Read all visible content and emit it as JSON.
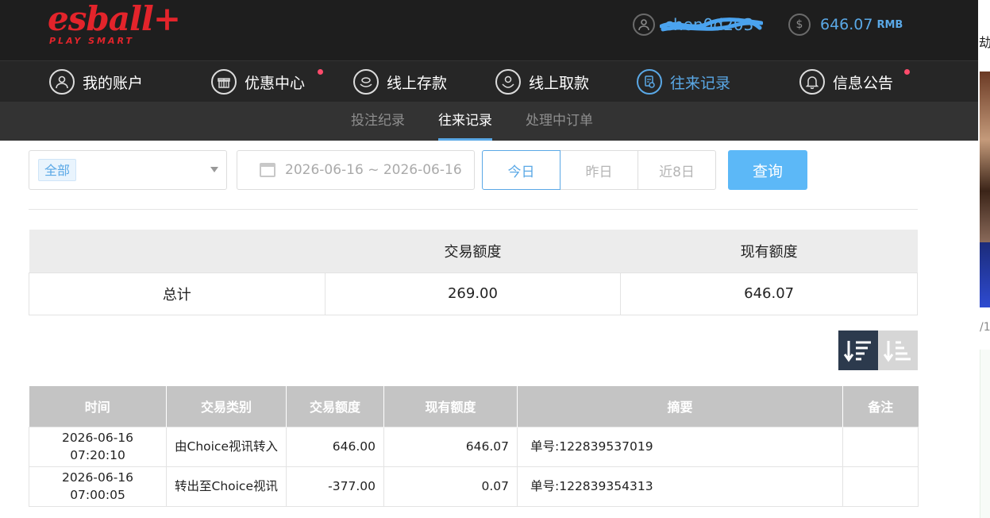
{
  "header": {
    "logo_text": "esball+",
    "logo_sub": "PLAY SMART",
    "username": "chen0d203",
    "balance": "646.07",
    "currency": "RMB"
  },
  "main_nav": [
    {
      "label": "我的账户",
      "icon": "user-icon",
      "active": false,
      "dot": false
    },
    {
      "label": "优惠中心",
      "icon": "gift-icon",
      "active": false,
      "dot": true
    },
    {
      "label": "线上存款",
      "icon": "deposit-icon",
      "active": false,
      "dot": false
    },
    {
      "label": "线上取款",
      "icon": "withdraw-icon",
      "active": false,
      "dot": false
    },
    {
      "label": "往来记录",
      "icon": "record-icon",
      "active": true,
      "dot": false
    },
    {
      "label": "信息公告",
      "icon": "bell-icon",
      "active": false,
      "dot": true
    }
  ],
  "sub_nav": [
    {
      "label": "投注纪录",
      "active": false
    },
    {
      "label": "往来记录",
      "active": true
    },
    {
      "label": "处理中订单",
      "active": false
    }
  ],
  "filter": {
    "type_selected": "全部",
    "date_range": "2026-06-16 ~ 2026-06-16",
    "day_buttons": [
      "今日",
      "昨日",
      "近8日"
    ],
    "query_label": "查询"
  },
  "summary": {
    "headers": [
      "",
      "交易额度",
      "现有额度"
    ],
    "row_label": "总计",
    "trade_total": "269.00",
    "current_total": "646.07"
  },
  "records": {
    "headers": [
      "时间",
      "交易类别",
      "交易额度",
      "现有额度",
      "摘要",
      "备注"
    ],
    "rows": [
      {
        "time": "2026-06-16 07:20:10",
        "type": "由Choice视讯转入",
        "amount": "646.00",
        "balance": "646.07",
        "summary": "单号:122839537019",
        "note": ""
      },
      {
        "time": "2026-06-16 07:00:05",
        "type": "转出至Choice视讯",
        "amount": "-377.00",
        "balance": "0.07",
        "summary": "单号:122839354313",
        "note": ""
      }
    ]
  },
  "right_strip": {
    "char": "劫",
    "text": "/1"
  },
  "colors": {
    "accent": "#5aa8e6",
    "brand": "#e3242b",
    "header_bg": "#1e1e1e",
    "query_btn": "#5cb8f7"
  }
}
